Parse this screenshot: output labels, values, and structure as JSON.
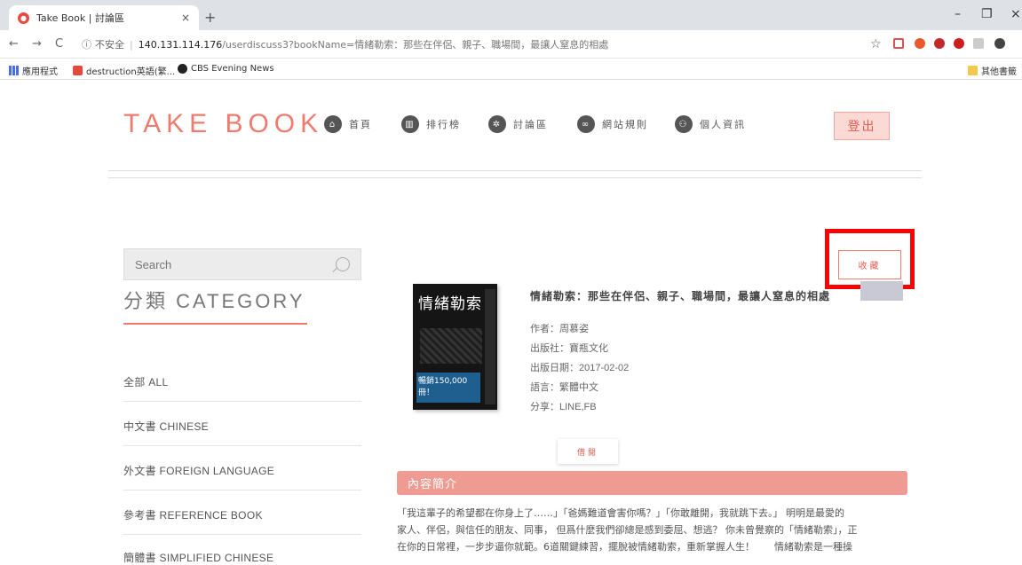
{
  "browser": {
    "tab_title": "Take Book | 討論區",
    "tab_close": "×",
    "new_tab": "+",
    "window": {
      "minimize": "–",
      "restore": "❐",
      "close": "×"
    },
    "nav": {
      "back": "←",
      "forward": "→",
      "reload": "C"
    },
    "security_label": "不安全",
    "url_host": "140.131.114.176",
    "url_path": "/userdiscuss3?bookName=情緒勒索：那些在伴侶、親子、職場間，最讓人窒息的相處",
    "star": "☆",
    "bookmarks": [
      {
        "label": "應用程式",
        "icon": "apps-grid-icon"
      },
      {
        "label": "destruction英語(繁...",
        "icon": "bookmark-favicon"
      },
      {
        "label": "CBS Evening News",
        "icon": "cbs-eye-icon"
      }
    ],
    "other_bookmarks": "其他書籤"
  },
  "header": {
    "logo": "TAKE BOOK",
    "nav": [
      {
        "label": "首頁",
        "icon": "home-icon"
      },
      {
        "label": "排行榜",
        "icon": "chart-icon"
      },
      {
        "label": "討論區",
        "icon": "gear-icon"
      },
      {
        "label": "網站規則",
        "icon": "link-icon"
      },
      {
        "label": "個人資訊",
        "icon": "users-icon"
      }
    ],
    "logout": "登出"
  },
  "sidebar": {
    "search_placeholder": "Search",
    "category_title": "分類 CATEGORY",
    "categories": [
      "全部 ALL",
      "中文書 CHINESE",
      "外文書 FOREIGN LANGUAGE",
      "參考書 REFERENCE BOOK",
      "簡體書 SIMPLIFIED CHINESE"
    ]
  },
  "book": {
    "collect_button": "收藏",
    "title": "情緒勒索：那些在伴侶、親子、職場間，最讓人窒息的相處",
    "author": "作者：周慕姿",
    "publisher": "出版社：寶瓶文化",
    "date": "出版日期：2017-02-02",
    "language": "語言：繁體中文",
    "share": "分享：LINE,FB",
    "borrow_button": "借閱",
    "cover": {
      "title": "情緒勒索",
      "band": "暢銷150,000冊！"
    }
  },
  "intro": {
    "heading": "內容簡介",
    "lines": [
      "「我這輩子的希望都在你身上了……」「爸媽難道會害你嗎？」「你敢離開，我就跳下去。」 明明是最愛的",
      "家人、伴侶，與信任的朋友、同事， 但爲什麼我們卻總是感到委屈、想逃？ 你未曾覺察的「情緒勒索」，正",
      "在你的日常裡，一步步逼你就範。6道關鍵練習，擺脫被情緒勒索，重新掌握人生！　　情緒勒索是一種操"
    ]
  }
}
